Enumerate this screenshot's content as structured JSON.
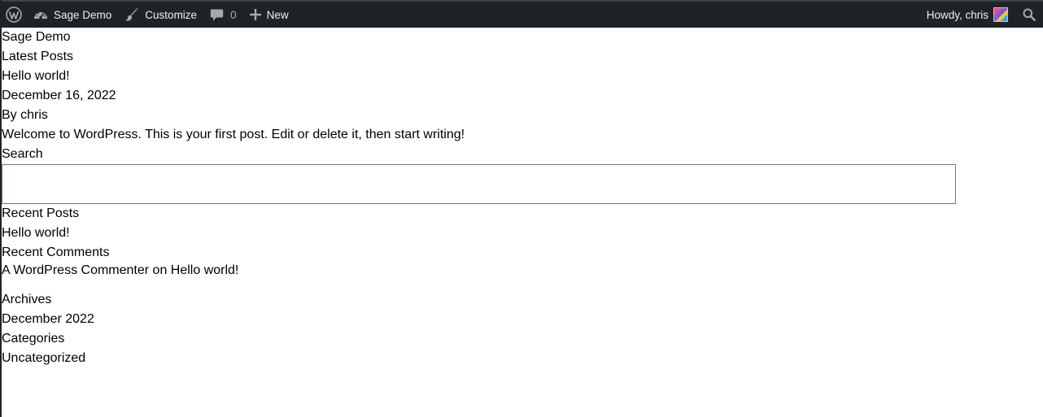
{
  "adminbar": {
    "site_name": "Sage Demo",
    "customize_label": "Customize",
    "comments_count": "0",
    "new_label": "New",
    "howdy_text": "Howdy, chris",
    "colors": {
      "background": "#1d2327",
      "text": "#f0f0f1",
      "icon": "#a7aaad"
    },
    "icons": [
      "wordpress-logo-icon",
      "dashboard-icon",
      "brush-icon",
      "comment-icon",
      "plus-icon",
      "search-icon"
    ]
  },
  "site": {
    "title": "Sage Demo"
  },
  "main": {
    "heading": "Latest Posts",
    "post": {
      "title": "Hello world!",
      "date": "December 16, 2022",
      "byline": "By chris",
      "excerpt": "Welcome to WordPress. This is your first post. Edit or delete it, then start writing!"
    }
  },
  "sidebar": {
    "search_label": "Search",
    "search_value": "",
    "recent_posts": {
      "heading": "Recent Posts",
      "items": [
        "Hello world!"
      ]
    },
    "recent_comments": {
      "heading": "Recent Comments",
      "author": "A WordPress Commenter",
      "on_text": " on ",
      "post": "Hello world!"
    },
    "archives": {
      "heading": "Archives",
      "items": [
        "December 2022"
      ]
    },
    "categories": {
      "heading": "Categories",
      "items": [
        "Uncategorized"
      ]
    }
  }
}
